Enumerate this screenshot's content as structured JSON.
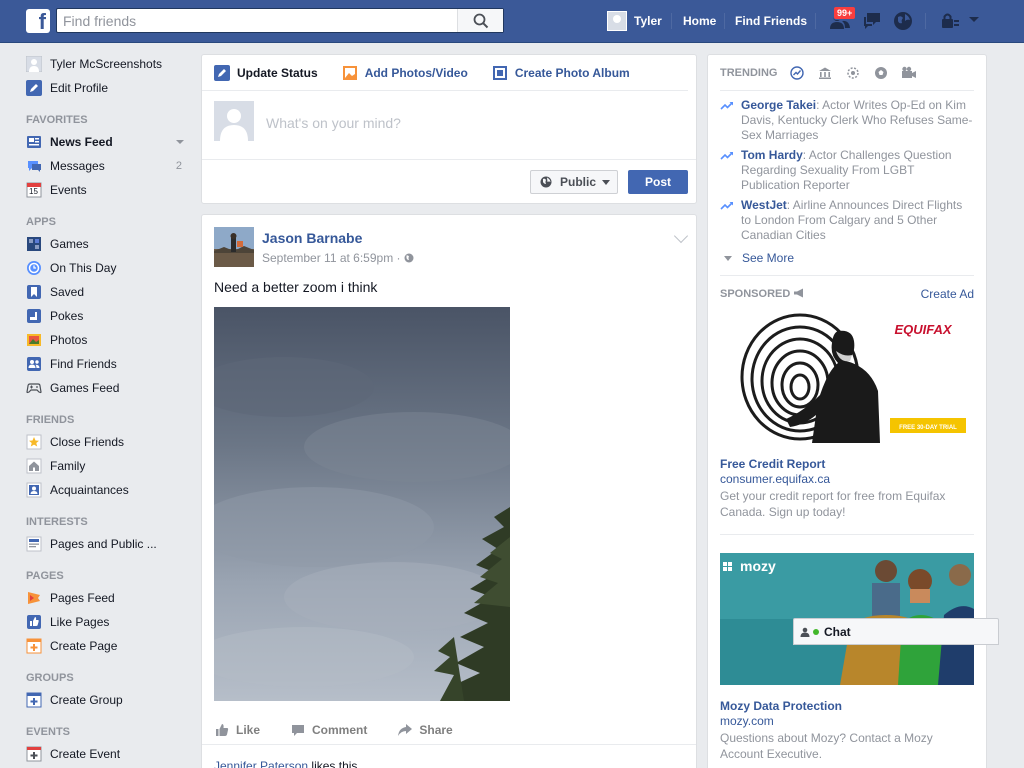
{
  "topbar": {
    "logo": "f",
    "search_placeholder": "Find friends",
    "user_name": "Tyler",
    "home": "Home",
    "find_friends": "Find Friends",
    "notif_count": "99+",
    "brand_color": "#3b5998"
  },
  "leftnav": {
    "profile_name": "Tyler McScreenshots",
    "edit_profile": "Edit Profile",
    "favorites_head": "FAVORITES",
    "favorites": [
      {
        "label": "News Feed",
        "icon": "news-feed-icon"
      },
      {
        "label": "Messages",
        "count": "2",
        "icon": "messages-icon"
      },
      {
        "label": "Events",
        "icon": "events-icon",
        "icon_text": "15"
      }
    ],
    "apps_head": "APPS",
    "apps": [
      {
        "label": "Games",
        "icon": "games-icon"
      },
      {
        "label": "On This Day",
        "icon": "on-this-day-icon"
      },
      {
        "label": "Saved",
        "icon": "saved-icon"
      },
      {
        "label": "Pokes",
        "icon": "pokes-icon"
      },
      {
        "label": "Photos",
        "icon": "photos-icon"
      },
      {
        "label": "Find Friends",
        "icon": "find-friends-icon"
      },
      {
        "label": "Games Feed",
        "icon": "games-feed-icon"
      }
    ],
    "friends_head": "FRIENDS",
    "friends": [
      {
        "label": "Close Friends",
        "icon": "star-icon"
      },
      {
        "label": "Family",
        "icon": "family-icon"
      },
      {
        "label": "Acquaintances",
        "icon": "acquaintances-icon"
      }
    ],
    "interests_head": "INTERESTS",
    "interests": [
      {
        "label": "Pages and Public ...",
        "icon": "pages-public-icon"
      }
    ],
    "pages_head": "PAGES",
    "pages": [
      {
        "label": "Pages Feed",
        "icon": "pages-feed-icon"
      },
      {
        "label": "Like Pages",
        "icon": "like-pages-icon"
      },
      {
        "label": "Create Page",
        "icon": "create-page-icon"
      }
    ],
    "groups_head": "GROUPS",
    "groups": [
      {
        "label": "Create Group",
        "icon": "create-group-icon"
      }
    ],
    "events_head": "EVENTS",
    "events": [
      {
        "label": "Create Event",
        "icon": "create-event-icon"
      }
    ]
  },
  "composer": {
    "tab_update": "Update Status",
    "tab_photos": "Add Photos/Video",
    "tab_album": "Create Photo Album",
    "placeholder": "What's on your mind?",
    "privacy": "Public",
    "post_button": "Post"
  },
  "post": {
    "author": "Jason Barnabe",
    "time": "September 11 at 6:59pm ·",
    "text": "Need a better zoom i think",
    "like": "Like",
    "comment": "Comment",
    "share": "Share",
    "liker": "Jennifer Paterson",
    "likes_suffix": " likes this."
  },
  "trending": {
    "title": "TRENDING",
    "items": [
      {
        "name": "George Takei",
        "text": ": Actor Writes Op-Ed on Kim Davis, Kentucky Clerk Who Refuses Same-Sex Marriages"
      },
      {
        "name": "Tom Hardy",
        "text": ": Actor Challenges Question Regarding Sexuality From LGBT Publication Reporter"
      },
      {
        "name": "WestJet",
        "text": ": Airline Announces Direct Flights to London From Calgary and 5 Other Canadian Cities"
      }
    ],
    "see_more": "See More"
  },
  "sponsored": {
    "title": "SPONSORED",
    "create_ad": "Create Ad",
    "ads": [
      {
        "brand": "EQUIFAX",
        "cta": "FREE 30-DAY TRIAL",
        "title": "Free Credit Report",
        "url": "consumer.equifax.ca",
        "desc": "Get your credit report for free from Equifax Canada. Sign up today!"
      },
      {
        "brand": "mozy",
        "title": "Mozy Data Protection",
        "url": "mozy.com",
        "desc": "Questions about Mozy? Contact a Mozy Account Executive."
      }
    ]
  },
  "chat": {
    "label": "Chat"
  }
}
